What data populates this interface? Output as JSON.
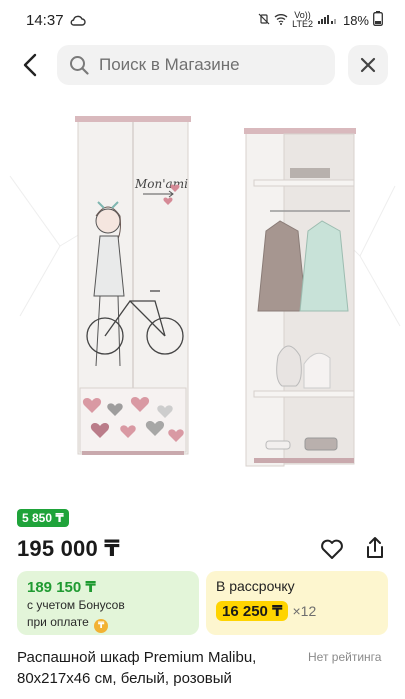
{
  "status_bar": {
    "time": "14:37",
    "battery": "18%",
    "network_top": "Vo))",
    "network_bottom": "LTE2"
  },
  "search": {
    "placeholder": "Поиск в Магазине"
  },
  "product": {
    "bonus_badge": "5 850 ₸",
    "price": "195 000 ₸",
    "bonus_price": "189 150 ₸",
    "bonus_note_line1": "с учетом Бонусов",
    "bonus_note_line2": "при оплате",
    "installment_title": "В рассрочку",
    "installment_amount": "16 250 ₸",
    "installment_multiplier": "×12",
    "title_line1": "Распашной шкаф Premium Malibu,",
    "title_line2": "80x217x46 см, белый, розовый",
    "rating_text": "Нет рейтинга",
    "decor_text": "Mon'ami"
  },
  "colors": {
    "accent_green": "#1fa33a",
    "bonus_card_bg": "#e3f5d9",
    "install_card_bg": "#fdf6cf",
    "install_pill": "#ffd400"
  }
}
